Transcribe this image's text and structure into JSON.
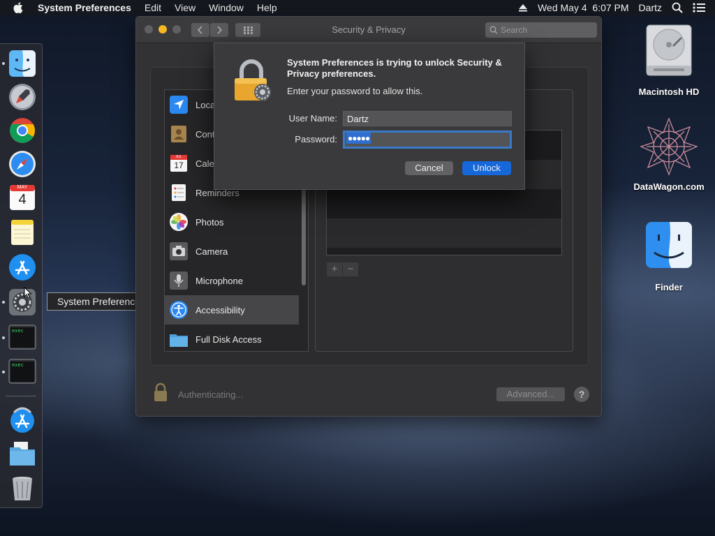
{
  "menubar": {
    "app_name": "System Preferences",
    "menus": [
      "Edit",
      "View",
      "Window",
      "Help"
    ],
    "datetime": "Wed May 4  6:07 PM",
    "user": "Dartz",
    "icons": [
      "apple-icon",
      "eject-icon",
      "spotlight-search-icon",
      "notification-center-icon"
    ]
  },
  "dock": {
    "tooltip": "System Preferences",
    "calendar_month": "MAY",
    "calendar_day": "4",
    "terminal_text": "exec",
    "items": [
      "finder",
      "launchpad",
      "chrome",
      "safari",
      "calendar",
      "notes",
      "app-store",
      "system-preferences",
      "terminal",
      "terminal",
      "app-store-downloads",
      "downloads-folder",
      "trash"
    ]
  },
  "window": {
    "title": "Security & Privacy",
    "search_placeholder": "Search",
    "privacy_list": [
      {
        "label": "Loca",
        "icon": "location-icon"
      },
      {
        "label": "Cont",
        "icon": "contacts-icon"
      },
      {
        "label": "Cale",
        "icon": "calendar-icon"
      },
      {
        "label": "Reminders",
        "icon": "reminders-icon"
      },
      {
        "label": "Photos",
        "icon": "photos-icon"
      },
      {
        "label": "Camera",
        "icon": "camera-icon"
      },
      {
        "label": "Microphone",
        "icon": "microphone-icon"
      },
      {
        "label": "Accessibility",
        "icon": "accessibility-icon",
        "selected": true
      },
      {
        "label": "Full Disk Access",
        "icon": "folder-icon"
      }
    ],
    "calendar_icon_month": "JUL",
    "calendar_icon_day": "17",
    "add_label": "+",
    "remove_label": "−",
    "status": "Authenticating...",
    "advanced_label": "Advanced...",
    "help_label": "?"
  },
  "dialog": {
    "title": "System Preferences is trying to unlock Security & Privacy preferences.",
    "subtitle": "Enter your password to allow this.",
    "username_label": "User Name:",
    "username_value": "Dartz",
    "password_label": "Password:",
    "password_value": "●●●●●",
    "cancel_label": "Cancel",
    "unlock_label": "Unlock"
  },
  "desktop": {
    "icons": [
      {
        "label": "Macintosh HD",
        "icon": "hard-drive-icon"
      },
      {
        "label": "DataWagon.com",
        "icon": "datawagon-icon"
      },
      {
        "label": "Finder",
        "icon": "finder-icon"
      }
    ]
  }
}
